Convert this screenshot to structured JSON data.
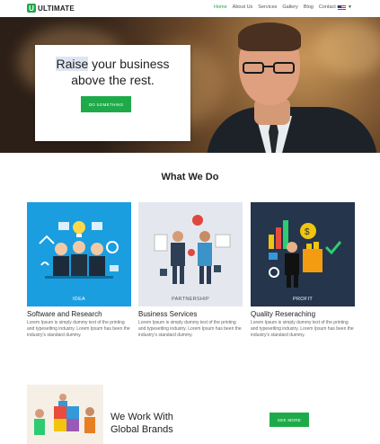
{
  "brand": {
    "logo_letter": "U",
    "name": "ULTIMATE",
    "accent": "#1faa4a"
  },
  "nav": {
    "items": [
      {
        "label": "Home",
        "active": true
      },
      {
        "label": "About Us",
        "active": false
      },
      {
        "label": "Services",
        "active": false
      },
      {
        "label": "Gallery",
        "active": false
      },
      {
        "label": "Blog",
        "active": false
      },
      {
        "label": "Contact us",
        "active": false
      }
    ],
    "language_flag": "us-flag-icon"
  },
  "hero": {
    "title_highlight": "Raise",
    "title_rest": " your business",
    "title_line2": "above the rest.",
    "button_label": "DO SOMETHING"
  },
  "services": {
    "title": "What We Do",
    "cards": [
      {
        "image_caption": "IDEA",
        "title": "Software and Research",
        "text": "Lorem Ipsum is simply dummy text of the printing and typesetting industry. Lorem Ipsum has been the industry's standard dummy."
      },
      {
        "image_caption": "PARTNERSHIP",
        "title": "Business Services",
        "text": "Lorem Ipsum is simply dummy text of the printing and typesetting industry. Lorem Ipsum has been the industry's standard dummy."
      },
      {
        "image_caption": "PROFIT",
        "title": "Quality Reseraching",
        "text": "Lorem Ipsum is simply dummy text of the printing and typesetting industry. Lorem Ipsum has been the industry's standard dummy."
      }
    ]
  },
  "brands": {
    "title_line1": "We Work With",
    "title_line2": "Global Brands",
    "button_label": "SEE MORE"
  }
}
